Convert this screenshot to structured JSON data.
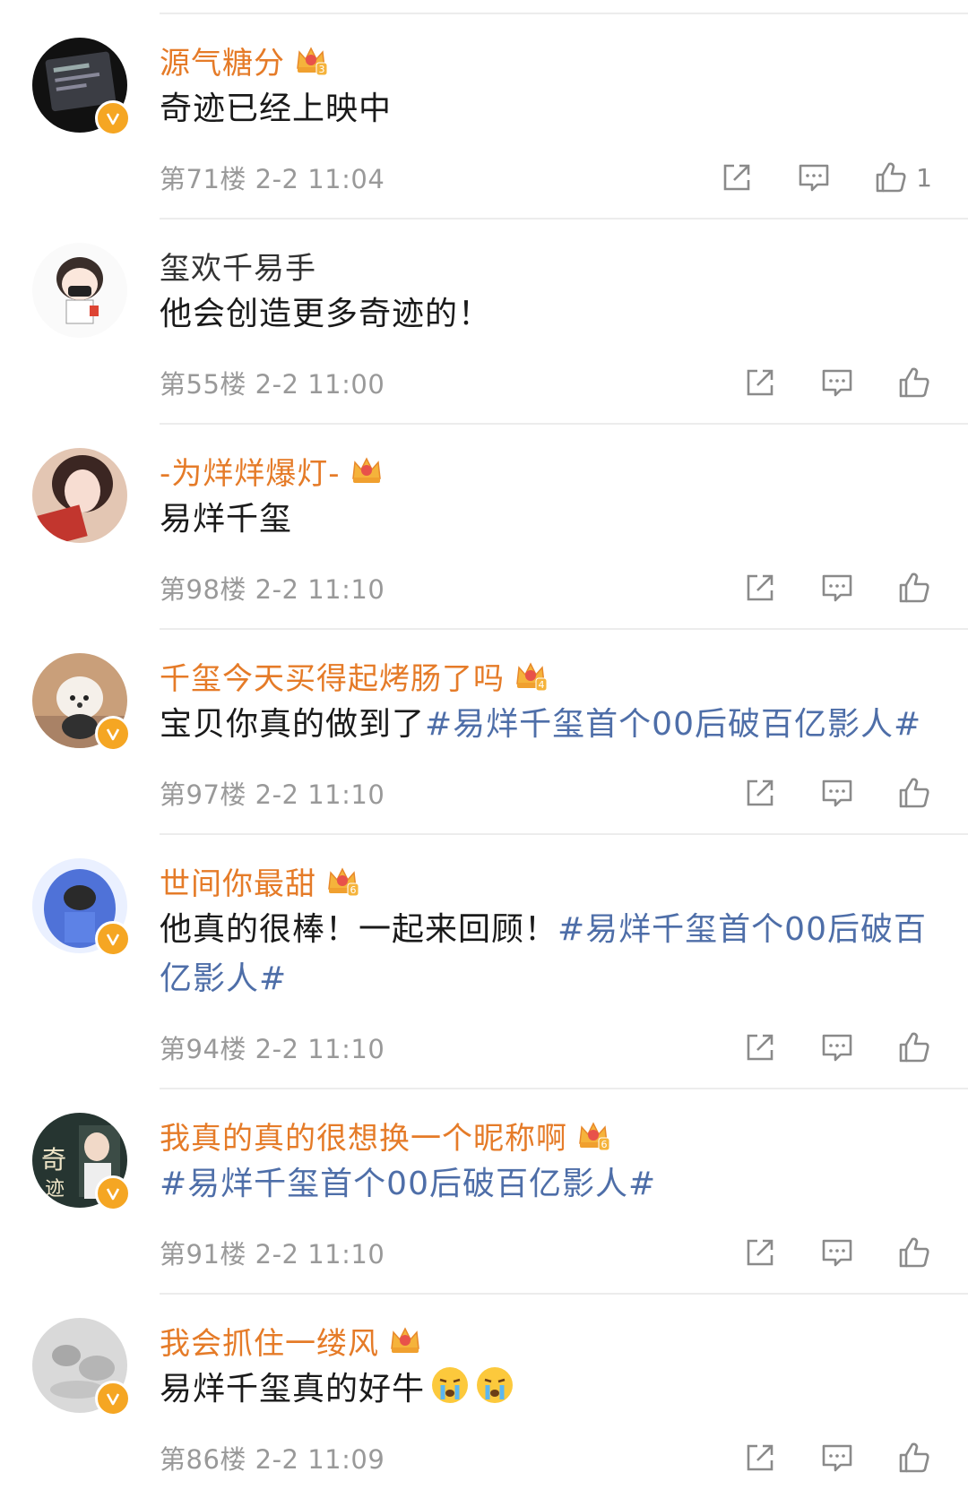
{
  "comments": [
    {
      "username": "源气糖分",
      "name_colored": true,
      "verified": true,
      "crown_level": "3",
      "text": "奇迹已经上映中",
      "hashtag": "",
      "emoji_count": 0,
      "floor": "第71楼",
      "time": "2-2 11:04",
      "likes": "1",
      "avatar": "phone-screen",
      "avatar_color": "#1c1c1c"
    },
    {
      "username": "玺欢千易手",
      "name_colored": false,
      "verified": false,
      "crown_level": "",
      "text": "他会创造更多奇迹的！",
      "hashtag": "",
      "emoji_count": 0,
      "floor": "第55楼",
      "time": "2-2 11:00",
      "likes": "",
      "avatar": "cartoon-boy",
      "avatar_color": "#f4f4f4"
    },
    {
      "username": "-为烊烊爆灯-",
      "name_colored": true,
      "verified": false,
      "crown_level": "",
      "text": "易烊千玺",
      "hashtag": "",
      "emoji_count": 0,
      "floor": "第98楼",
      "time": "2-2 11:10",
      "likes": "",
      "avatar": "girl-selfie",
      "avatar_color": "#c9846e"
    },
    {
      "username": "千玺今天买得起烤肠了吗",
      "name_colored": true,
      "verified": true,
      "crown_level": "4",
      "text": "宝贝你真的做到了",
      "hashtag": "#易烊千玺首个00后破百亿影人#",
      "emoji_count": 0,
      "floor": "第97楼",
      "time": "2-2 11:10",
      "likes": "",
      "avatar": "white-dog",
      "avatar_color": "#b89573"
    },
    {
      "username": "世间你最甜",
      "name_colored": true,
      "verified": true,
      "crown_level": "6",
      "text": "他真的很棒！一起来回顾！",
      "hashtag": "#易烊千玺首个00后破百亿影人#",
      "emoji_count": 0,
      "floor": "第94楼",
      "time": "2-2 11:10",
      "likes": "",
      "avatar": "blue-hood",
      "avatar_color": "#5b7fd6"
    },
    {
      "username": "我真的真的很想换一个昵称啊",
      "name_colored": true,
      "verified": true,
      "crown_level": "6",
      "text": "",
      "hashtag": "#易烊千玺首个00后破百亿影人#",
      "emoji_count": 0,
      "floor": "第91楼",
      "time": "2-2 11:10",
      "likes": "",
      "avatar": "movie-poster",
      "avatar_color": "#2a3a35"
    },
    {
      "username": "我会抓住一缕风",
      "name_colored": true,
      "verified": true,
      "crown_level": "",
      "text": "易烊千玺真的好牛",
      "hashtag": "",
      "emoji_count": 2,
      "floor": "第86楼",
      "time": "2-2 11:09",
      "likes": "",
      "avatar": "grey-blur",
      "avatar_color": "#c9c9c9"
    }
  ],
  "icons": {
    "share": "share-icon",
    "comment": "comment-icon",
    "like": "thumbs-up-icon",
    "verified": "verified-badge-icon",
    "crown": "crown-member-icon",
    "emoji": "crying-emoji-icon"
  },
  "colors": {
    "username_vip": "#e57b28",
    "hashtag": "#4e6ea8",
    "meta": "#999999",
    "badge": "#f5a623"
  }
}
